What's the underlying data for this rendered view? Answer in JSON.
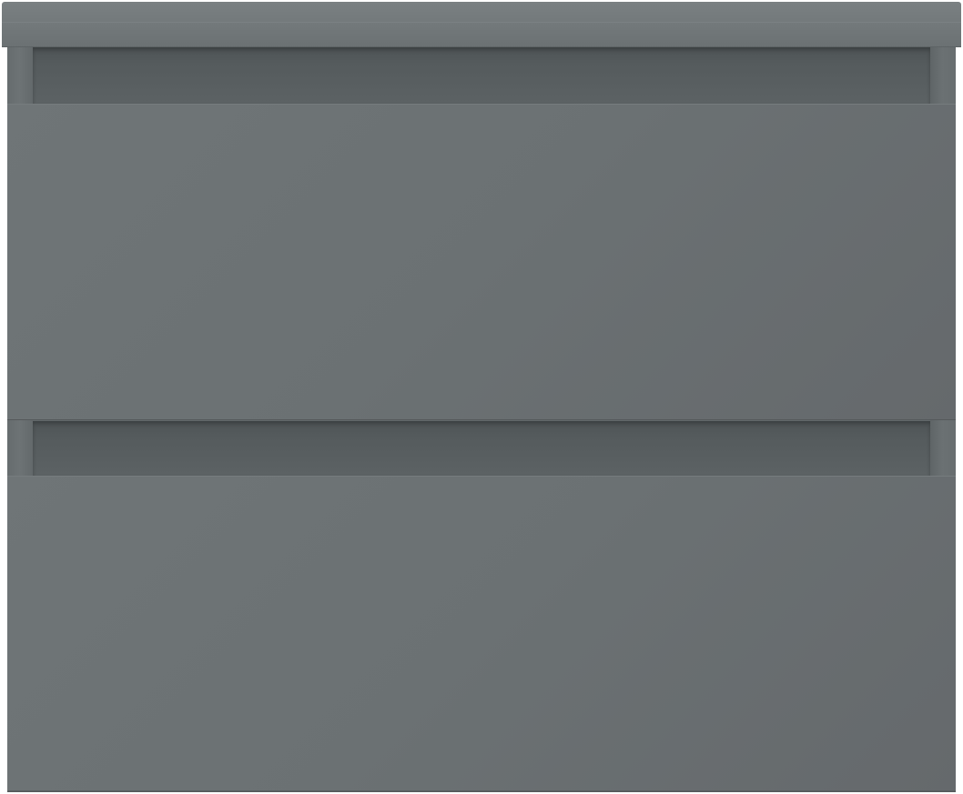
{
  "product": {
    "type": "wall-hung vanity cabinet",
    "drawer_count": 2,
    "handle_style": "handleless grip recess",
    "colors": {
      "finish": "#6b7173",
      "top": "#777d7f",
      "recess": "#52585a",
      "background": "#ffffff"
    }
  }
}
